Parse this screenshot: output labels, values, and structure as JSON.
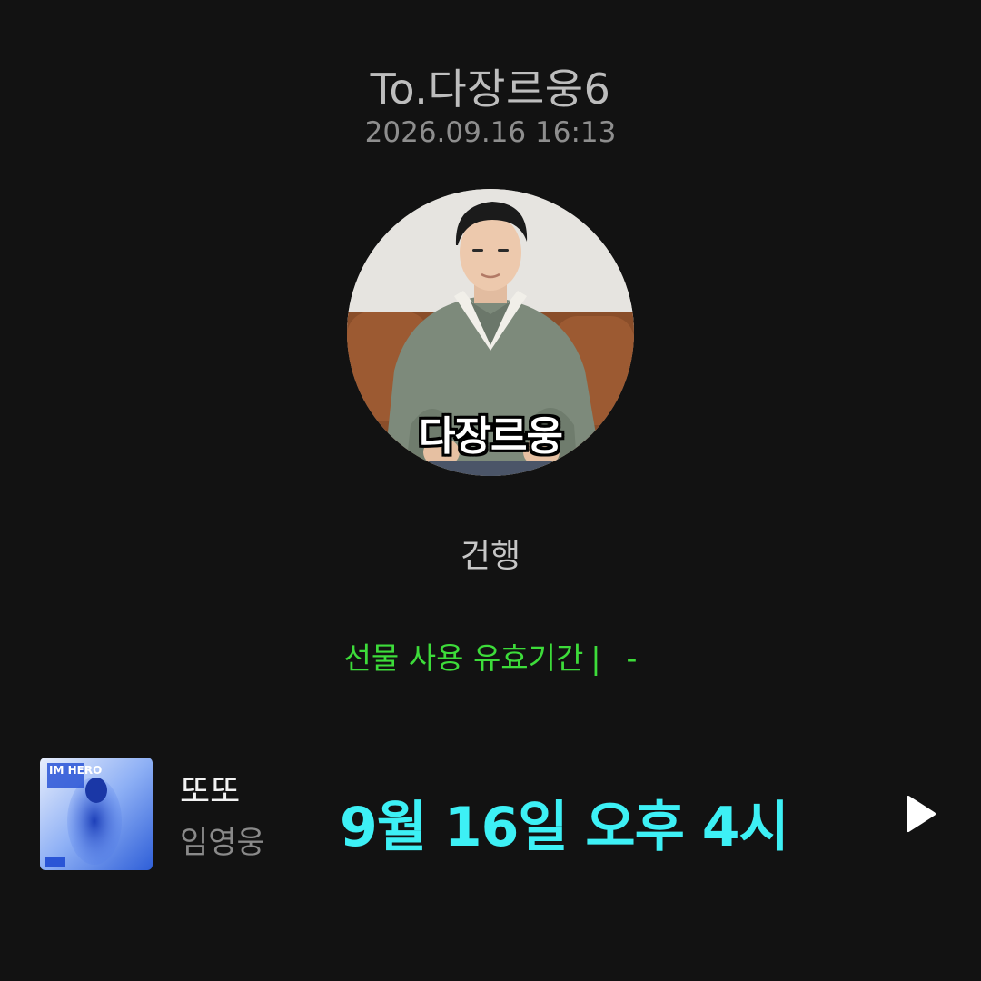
{
  "header": {
    "recipient": "To.다장르웅6",
    "timestamp": "2026.09.16 16:13"
  },
  "profile": {
    "caption": "다장르웅"
  },
  "message": {
    "text": "건행"
  },
  "gift": {
    "validity_label": "선물 사용 유효기간",
    "separator": "|",
    "validity_value": "-",
    "label_color": "#3ddc3a"
  },
  "track": {
    "title": "또또",
    "artist": "임영웅",
    "album_art_text": "IM HERO",
    "overlay": "9월 16일 오후 4시",
    "overlay_color": "#3df0f5",
    "play_icon": "play-icon"
  }
}
